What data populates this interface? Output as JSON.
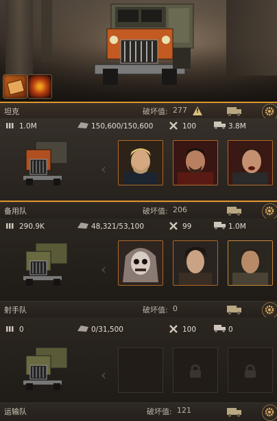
{
  "squads": [
    {
      "name": "坦克",
      "damage_label": "破坏值:",
      "damage_value": "277",
      "stats": {
        "power": "1.0M",
        "hp": "150,600/150,600",
        "repair": "100",
        "load": "3.8M"
      },
      "heroes": [
        "hero-blond-bearded",
        "hero-red-warrior",
        "hero-shouting-fighter"
      ]
    },
    {
      "name": "备用队",
      "damage_label": "破坏值:",
      "damage_value": "206",
      "stats": {
        "power": "290.9K",
        "hp": "48,321/53,100",
        "repair": "99",
        "load": "1.0M"
      },
      "heroes": [
        "hero-skull-mask",
        "hero-dark-hair",
        "hero-soldier"
      ]
    },
    {
      "name": "射手队",
      "damage_label": "破坏值:",
      "damage_value": "0",
      "stats": {
        "power": "0",
        "hp": "0/31,500",
        "repair": "100",
        "load": "0"
      },
      "heroes": []
    },
    {
      "name": "运输队",
      "damage_label": "破坏值:",
      "damage_value": "121"
    }
  ],
  "colors": {
    "accent": "#e0962e",
    "panel": "#2b2620",
    "text": "#e4ded4"
  },
  "icons": {
    "power": "ammo-icon",
    "hp": "armor-icon",
    "repair": "wrench-icon",
    "load": "cargo-truck-icon"
  }
}
